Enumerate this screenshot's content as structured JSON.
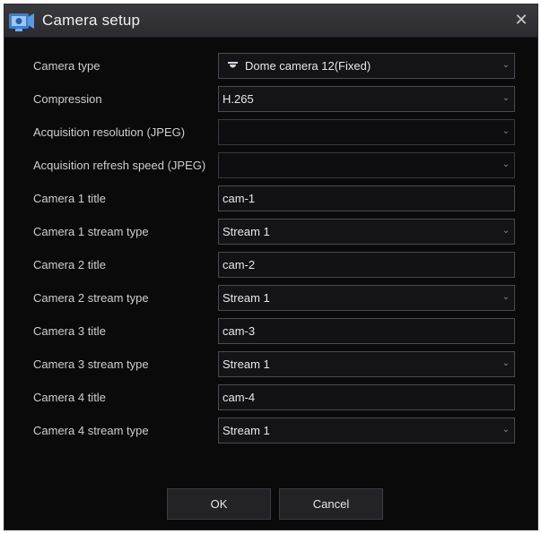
{
  "window": {
    "title": "Camera setup",
    "close_glyph": "✕"
  },
  "form": {
    "camera_type": {
      "label": "Camera type",
      "value": "Dome camera 12(Fixed)",
      "icon": "dome-camera-icon"
    },
    "compression": {
      "label": "Compression",
      "value": "H.265"
    },
    "acquisition_resolution": {
      "label": "Acquisition resolution (JPEG)",
      "value": ""
    },
    "acquisition_refresh_speed": {
      "label": "Acquisition refresh speed (JPEG)",
      "value": ""
    },
    "cameras": [
      {
        "title_label": "Camera 1 title",
        "title_value": "cam-1",
        "stream_label": "Camera 1 stream type",
        "stream_value": "Stream 1"
      },
      {
        "title_label": "Camera 2 title",
        "title_value": "cam-2",
        "stream_label": "Camera 2 stream type",
        "stream_value": "Stream 1"
      },
      {
        "title_label": "Camera 3 title",
        "title_value": "cam-3",
        "stream_label": "Camera 3 stream type",
        "stream_value": "Stream 1"
      },
      {
        "title_label": "Camera 4 title",
        "title_value": "cam-4",
        "stream_label": "Camera 4 stream type",
        "stream_value": "Stream 1"
      }
    ]
  },
  "buttons": {
    "ok": "OK",
    "cancel": "Cancel"
  },
  "colors": {
    "background": "#0a0a0b",
    "titlebar": "#2c2c30",
    "field_border": "#4a4a4f",
    "text": "#cfcfd3"
  }
}
